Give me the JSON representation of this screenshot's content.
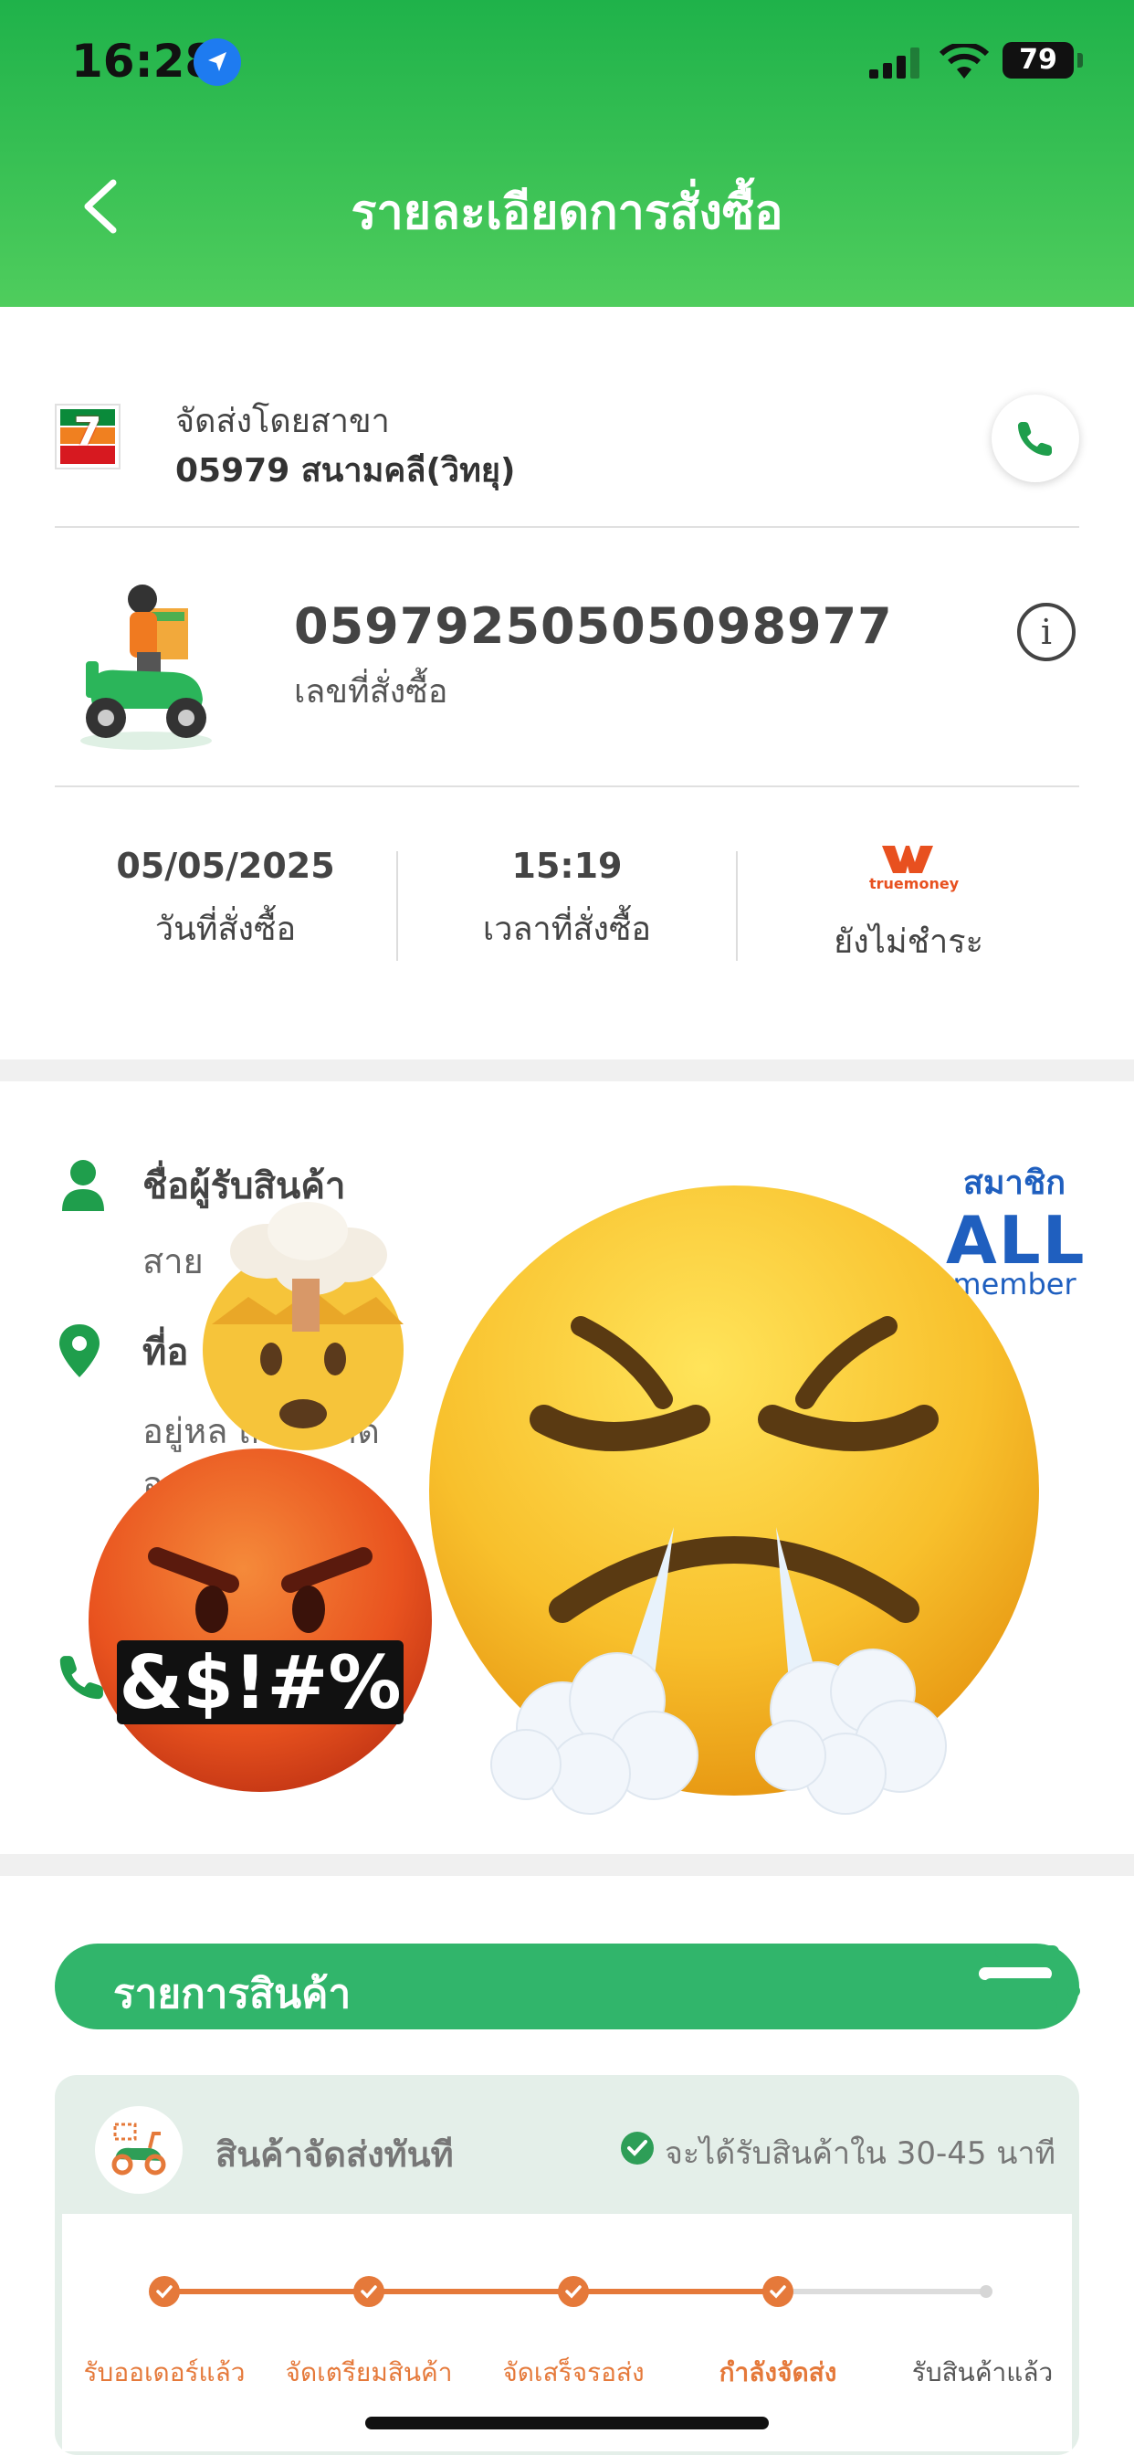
{
  "status_bar": {
    "time": "16:28",
    "battery": "79"
  },
  "header": {
    "title": "รายละเอียดการสั่งซื้อ"
  },
  "branch": {
    "label": "จัดส่งโดยสาขา",
    "name": "05979 สนามคลี(วิทยุ)"
  },
  "order": {
    "number": "05979250505098977",
    "number_label": "เลขที่สั่งซื้อ"
  },
  "summary": {
    "date_value": "05/05/2025",
    "date_label": "วันที่สั่งซื้อ",
    "time_value": "15:19",
    "time_label": "เวลาที่สั่งซื้อ",
    "payment_brand": "truemoney",
    "payment_label": "ยังไม่ชำระ"
  },
  "recipient": {
    "name_label": "ชื่อผู้รับสินค้า",
    "name_value": "สาย",
    "address_label": "ที่อ",
    "address_lines": [
      "อยู่หล              เกาเข้                                                      าด",
      "อ         ว  ซ้ำ  ร้าน",
      "                     บ"
    ],
    "member_top": "สมาชิก",
    "member_main": "ALL",
    "member_bottom": "member"
  },
  "emojis": {
    "exploding_head": "🤯",
    "cursing_face": "🤬",
    "steam_face": "😤"
  },
  "products": {
    "title": "รายการสินค้า",
    "delivery_type": "สินค้าจัดส่งทันที",
    "eta": "จะได้รับสินค้าใน 30-45 นาที",
    "steps": [
      "รับออเดอร์แล้ว",
      "จัดเตรียมสินค้า",
      "จัดเสร็จรอส่ง",
      "กำลังจัดส่ง",
      "รับสินค้าแล้ว"
    ],
    "completed_steps": 4
  },
  "colors": {
    "brand_green": "#31b56b",
    "progress_orange": "#e5793a",
    "member_blue": "#1f5fbf"
  }
}
